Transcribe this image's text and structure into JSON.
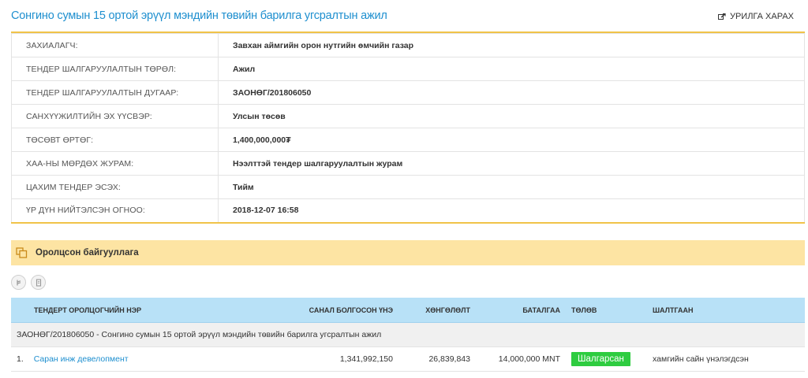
{
  "header": {
    "title": "Сонгино сумын 15 ортой эрүүл мэндийн төвийн барилга угсралтын ажил",
    "invite_link": "УРИЛГА ХАРАХ"
  },
  "info": [
    {
      "label": "ЗАХИАЛАГЧ:",
      "value": "Завхан аймгийн орон нутгийн өмчийн газар"
    },
    {
      "label": "ТЕНДЕР ШАЛГАРУУЛАЛТЫН ТӨРӨЛ:",
      "value": "Ажил"
    },
    {
      "label": "ТЕНДЕР ШАЛГАРУУЛАЛТЫН ДУГААР:",
      "value": "ЗАОНӨГ/201806050"
    },
    {
      "label": "САНХҮҮЖИЛТИЙН ЭХ ҮҮСВЭР:",
      "value": "Улсын төсөв"
    },
    {
      "label": "ТӨСӨВТ ӨРТӨГ:",
      "value": "1,400,000,000₮"
    },
    {
      "label": "ХАА-НЫ МӨРДӨХ ЖУРАМ:",
      "value": "Нээлттэй тендер шалгаруулалтын журам"
    },
    {
      "label": "ЦАХИМ ТЕНДЕР ЭСЭХ:",
      "value": "Тийм"
    },
    {
      "label": "ҮР ДҮН НИЙТЭЛСЭН ОГНОО:",
      "value": "2018-12-07 16:58"
    }
  ],
  "participants": {
    "section_title": "Оролцсон байгууллага",
    "columns": {
      "name": "ТЕНДЕРТ ОРОЛЦОГЧИЙН НЭР",
      "bid": "САНАЛ БОЛГОСОН ҮНЭ",
      "discount": "ХӨНГӨЛӨЛТ",
      "guarantee": "БАТАЛГАА",
      "status": "ТӨЛӨВ",
      "reason": "ШАЛТГААН"
    },
    "group_label": "ЗАОНӨГ/201806050 - Сонгино сумын 15 ортой эрүүл мэндийн төвийн барилга угсралтын ажил",
    "rows": [
      {
        "index": "1.",
        "name": "Саран инж девелопмент",
        "bid": "1,341,992,150",
        "discount": "26,839,843",
        "guarantee": "14,000,000 MNT",
        "status": "Шалгарсан",
        "reason": "хамгийн сайн үнэлэгдсэн"
      }
    ]
  },
  "colors": {
    "accent_blue": "#1e8fcf",
    "accent_yellow": "#f0c349",
    "section_bg": "#fde4a3",
    "table_header_bg": "#b8e1f7",
    "status_green": "#2ecc40"
  },
  "icons": {
    "invite": "external-link-icon",
    "section": "copy-icon",
    "btn1": "currency-icon",
    "btn2": "document-icon"
  }
}
